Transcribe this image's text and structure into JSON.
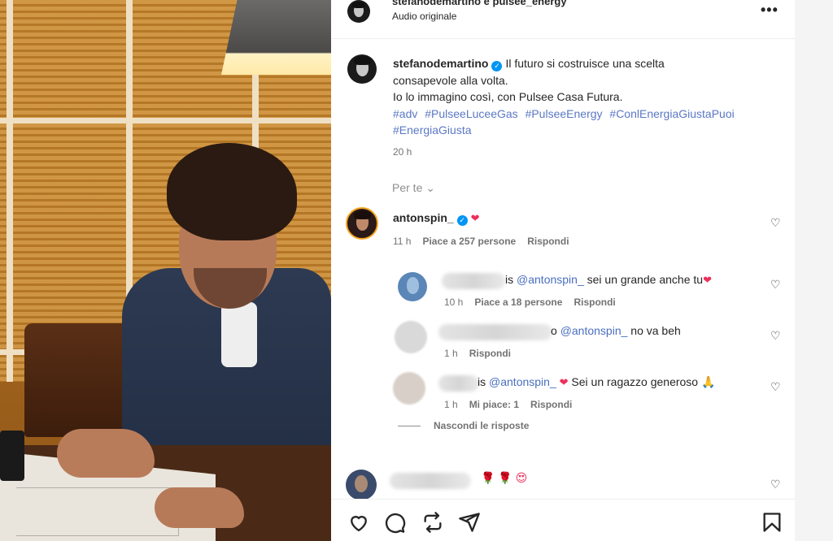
{
  "post": {
    "header_name": "stefanodemartino e pulsee_energy",
    "header_sub": "Audio originale",
    "more": "•••"
  },
  "caption": {
    "username": "stefanodemartino",
    "line1": "Il futuro si costruisce una scelta",
    "line2": "consapevole alla volta.",
    "line3": "Io lo immagino così, con Pulsee Casa Futura.",
    "hashtags": [
      "#adv",
      "#PulseeLuceeGas",
      "#PulseeEnergy",
      "#ConlEnergiaGiustaPuoi",
      "#EnergiaGiusta"
    ],
    "time": "20 h"
  },
  "sort": {
    "label": "Per te",
    "chevron": "⌄"
  },
  "comments": [
    {
      "username": "antonspin_",
      "emoji": "❤",
      "meta": {
        "time": "11 h",
        "likes": "Piace a 257 persone",
        "reply": "Rispondi"
      }
    }
  ],
  "replies": [
    {
      "name_suffix": "is",
      "mention": "@antonspin_",
      "text": "sei un grande anche tu",
      "emoji": "❤",
      "meta": {
        "time": "10 h",
        "likes": "Piace a 18 persone",
        "reply": "Rispondi"
      }
    },
    {
      "name_suffix": "o",
      "mention": "@antonspin_",
      "text": "no va beh",
      "meta": {
        "time": "1 h",
        "reply": "Rispondi"
      }
    },
    {
      "name_suffix": "is",
      "mention": "@antonspin_",
      "emoji": "❤",
      "text": "Sei un ragazzo generoso",
      "trailing_emoji": "🙏",
      "meta": {
        "time": "1 h",
        "likes": "Mi piace: 1",
        "reply": "Rispondi"
      }
    }
  ],
  "hide_replies": "Nascondi le risposte",
  "last_comment": {
    "emojis": "🌹 🌹 😍"
  },
  "colors": {
    "accent_link": "#4a6fc0",
    "heart": "#ed2f5a",
    "verified": "#0095f6"
  },
  "icons": [
    "heart-icon",
    "comment-icon",
    "share-icon",
    "send-icon",
    "bookmark-icon"
  ]
}
